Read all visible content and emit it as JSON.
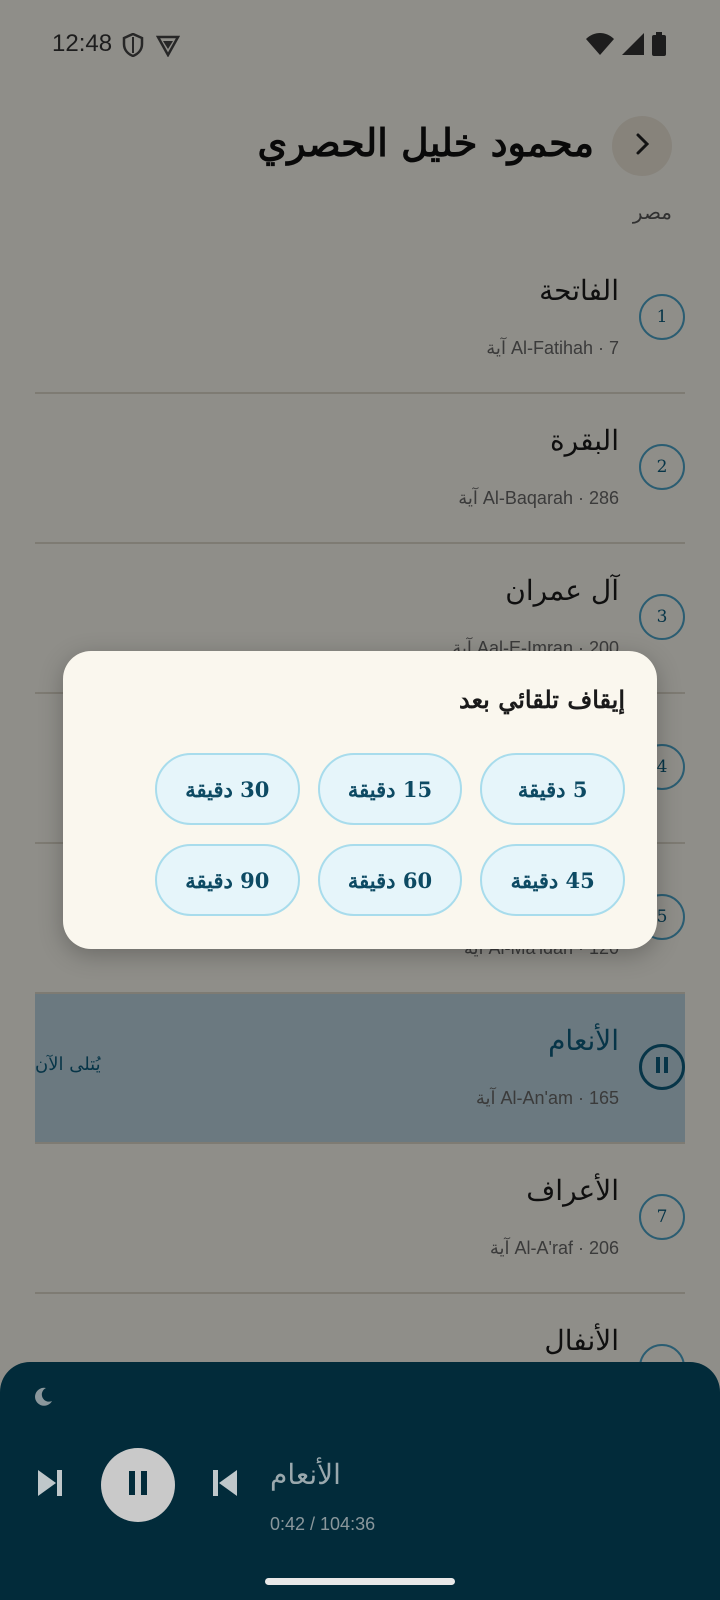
{
  "status_bar": {
    "time": "12:48"
  },
  "header": {
    "reciter": "محمود خليل الحصري",
    "country": "مصر"
  },
  "surahs": [
    {
      "number": "1",
      "name": "الفاتحة",
      "meta": "Al-Fatihah · 7 آية"
    },
    {
      "number": "2",
      "name": "البقرة",
      "meta": "Al-Baqarah · 286 آية"
    },
    {
      "number": "3",
      "name": "آل عمران",
      "meta": "Aal-E-Imran · 200 آية"
    },
    {
      "number": "4",
      "name": "",
      "meta": ""
    },
    {
      "number": "5",
      "name": "",
      "meta": "Al-Ma'idah · 120 آية"
    },
    {
      "number": "",
      "name": "الأنعام",
      "meta": "Al-An'am · 165 آية",
      "now_playing": "يُتلى الآن"
    },
    {
      "number": "7",
      "name": "الأعراف",
      "meta": "Al-A'raf · 206 آية"
    },
    {
      "number": "",
      "name": "الأنفال",
      "meta": ""
    }
  ],
  "dialog": {
    "title": "إيقاف تلقائي بعد",
    "options": [
      "5 دقيقة",
      "15 دقيقة",
      "30 دقيقة",
      "45 دقيقة",
      "60 دقيقة",
      "90 دقيقة"
    ]
  },
  "player": {
    "title": "الأنعام",
    "time": "0:42 / 104:36"
  }
}
